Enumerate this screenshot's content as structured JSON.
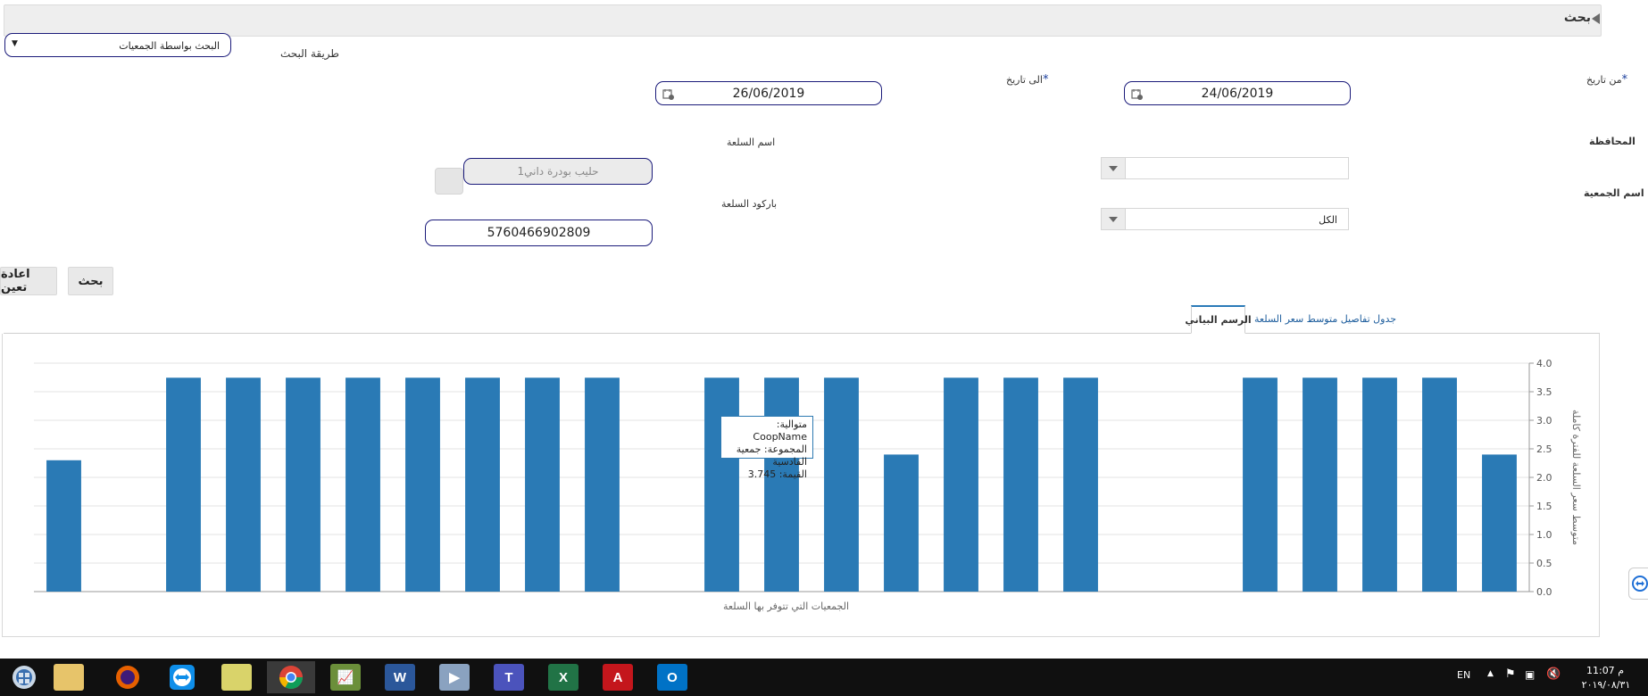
{
  "header": {
    "title": "بحث"
  },
  "search_method": {
    "label": "طريقة البحث",
    "value": "البحث بواسطة الجمعيات"
  },
  "from_date": {
    "label": "من تاريخ",
    "value": "24/06/2019",
    "required": "*"
  },
  "to_date": {
    "label": "الى تاريخ",
    "value": "26/06/2019",
    "required": "*"
  },
  "governorate": {
    "label": "المحافظة",
    "value": ""
  },
  "coop_name": {
    "label": "اسم الجمعية",
    "value": "الكل"
  },
  "product_name": {
    "label": "اسم السلعة",
    "value": "حليب بودرة داني1"
  },
  "barcode": {
    "label": "باركود السلعة",
    "value": "5760466902809"
  },
  "buttons": {
    "search": "بحث",
    "reset": "اعادة تعين"
  },
  "tabs": [
    {
      "label": "الرسم البياني",
      "active": true
    },
    {
      "label": "جدول تفاصيل متوسط سعر السلعة",
      "active": false
    }
  ],
  "chart_data": {
    "type": "bar",
    "xlabel": "الجمعيات التي تتوفر بها السلعة",
    "ylabel": "متوسط سعر السلعة للفترة كاملة",
    "ylim": [
      0,
      4
    ],
    "yticks": [
      "0.0",
      "0.5",
      "1.0",
      "1.5",
      "2.0",
      "2.5",
      "3.0",
      "3.5",
      "4.0"
    ],
    "values": [
      2.3,
      null,
      3.745,
      3.745,
      3.745,
      3.745,
      3.745,
      3.745,
      3.745,
      3.745,
      null,
      3.745,
      3.745,
      3.745,
      2.4,
      3.745,
      3.745,
      3.745,
      null,
      null,
      3.745,
      3.745,
      3.745,
      3.745,
      2.4
    ],
    "bar_color": "#2a7ab5",
    "grid": true
  },
  "tooltip": {
    "line1": "متوالية: CoopName",
    "line2": "المجموعة: جمعية القادسية",
    "line3": "القيمة: 3.745"
  },
  "taskbar": {
    "lang": "EN",
    "time": "11:07 م",
    "date": "٢٠١٩/٠٨/٣١"
  }
}
